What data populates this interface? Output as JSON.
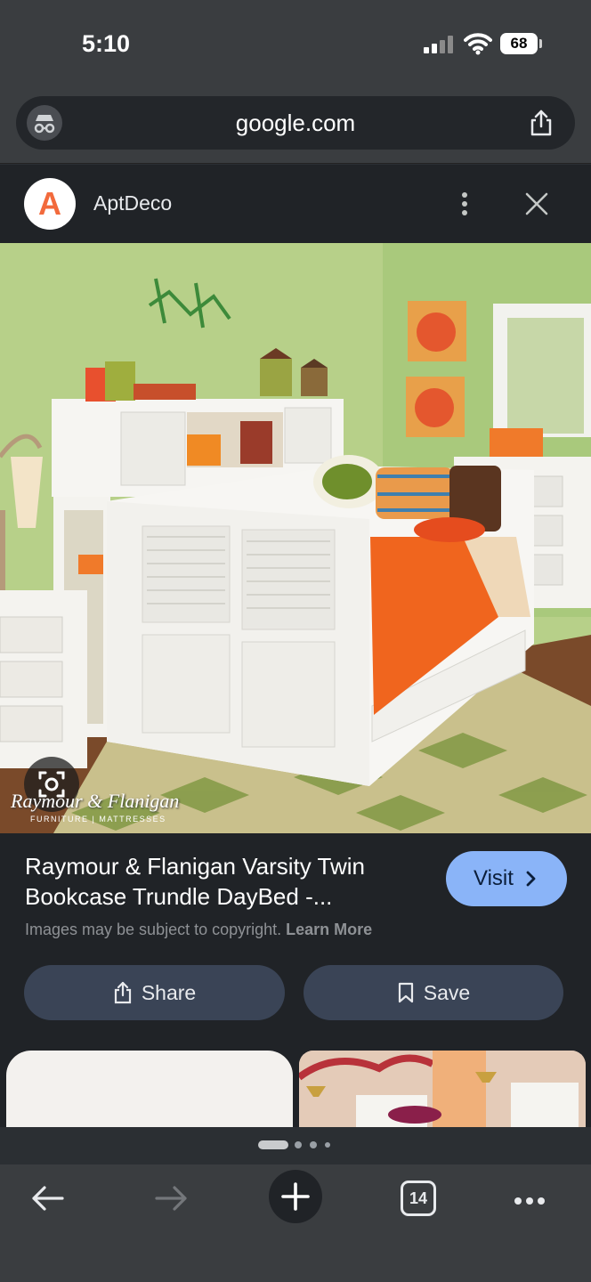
{
  "status_bar": {
    "time": "5:10",
    "battery": "68",
    "icons": [
      "signal-icon",
      "wifi-icon",
      "battery-icon"
    ]
  },
  "address_bar": {
    "domain": "google.com",
    "left_icon": "incognito-icon",
    "right_icon": "share-icon"
  },
  "source": {
    "name": "AptDeco",
    "logo_letter": "A",
    "menu_icon": "more-vertical-icon",
    "close_icon": "close-icon"
  },
  "image": {
    "watermark_main": "Raymour & Flanigan",
    "watermark_sub": "FURNITURE | MATTRESSES",
    "lens_icon": "lens-icon"
  },
  "result": {
    "title": "Raymour & Flanigan Varsity Twin Bookcase Trundle DayBed -...",
    "visit_label": "Visit",
    "copyright_text": "Images may be subject to copyright.",
    "learn_more": "Learn More",
    "share_label": "Share",
    "save_label": "Save"
  },
  "carousel": {
    "active_index": 0,
    "total_dots": 4
  },
  "toolbar": {
    "tab_count": "14",
    "icons": [
      "back-arrow-icon",
      "forward-arrow-icon",
      "new-tab-plus-icon",
      "tabs-icon",
      "more-horizontal-icon"
    ]
  },
  "colors": {
    "accent_button": "#8ab4f8",
    "secondary_button": "#3a4456",
    "panel": "#202327",
    "chrome": "#3a3d40"
  }
}
